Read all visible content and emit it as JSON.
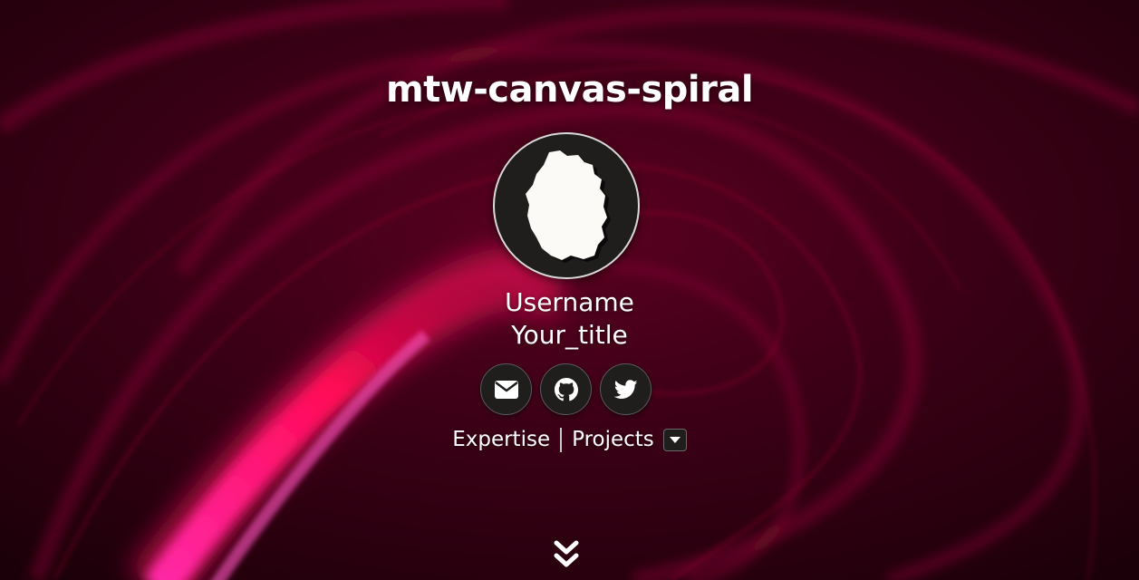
{
  "header": {
    "title": "mtw-canvas-spiral"
  },
  "profile": {
    "avatar_icon": "silhouette-map-icon",
    "username": "Username",
    "user_title": "Your_title"
  },
  "social": [
    {
      "name": "email",
      "icon": "envelope-icon"
    },
    {
      "name": "github",
      "icon": "github-icon"
    },
    {
      "name": "twitter",
      "icon": "twitter-icon"
    }
  ],
  "nav": {
    "expertise_label": "Expertise",
    "projects_label": "Projects",
    "dropdown_icon": "caret-down-icon"
  },
  "scroll": {
    "icon": "double-chevron-down-icon"
  },
  "colors": {
    "background": "#2a0010",
    "accent_streak": "#ff1a6a",
    "button_bg": "#1f1e1c",
    "text": "#ffffff"
  }
}
